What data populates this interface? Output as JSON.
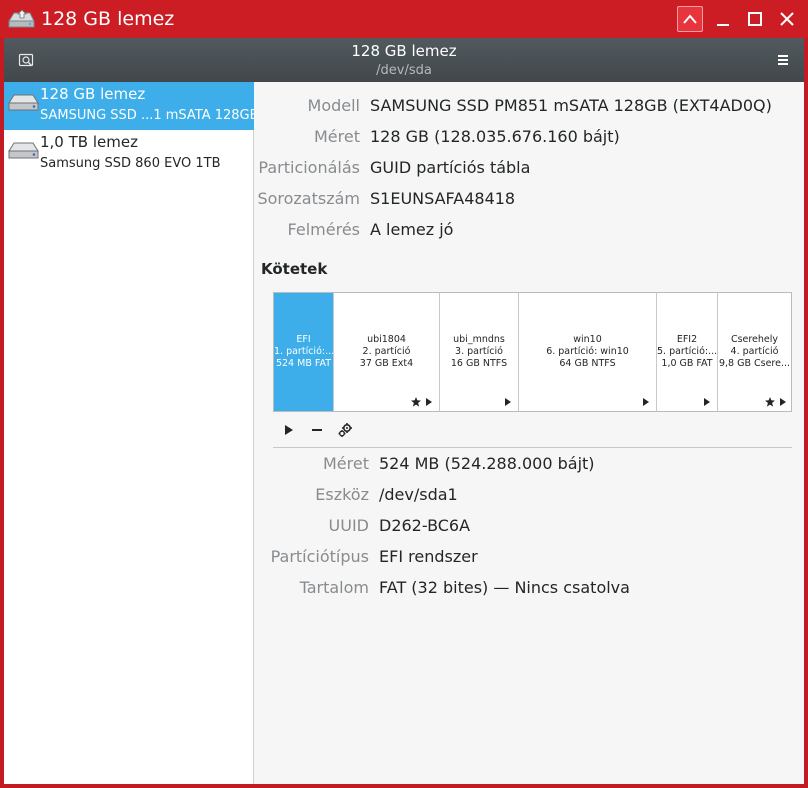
{
  "window": {
    "title": "128 GB lemez"
  },
  "header": {
    "title": "128 GB lemez",
    "subtitle": "/dev/sda"
  },
  "sidebar": {
    "drives": [
      {
        "name": "128 GB lemez",
        "subtitle": "SAMSUNG SSD ...1 mSATA 128GB",
        "selected": true
      },
      {
        "name": "1,0 TB lemez",
        "subtitle": "Samsung SSD 860 EVO 1TB",
        "selected": false
      }
    ]
  },
  "disk_info": [
    {
      "label": "Modell",
      "value": "SAMSUNG SSD PM851 mSATA 128GB (EXT4AD0Q)"
    },
    {
      "label": "Méret",
      "value": "128 GB (128.035.676.160 bájt)"
    },
    {
      "label": "Particionálás",
      "value": "GUID partíciós tábla"
    },
    {
      "label": "Sorozatszám",
      "value": "S1EUNSAFA48418"
    },
    {
      "label": "Felmérés",
      "value": "A lemez jó"
    }
  ],
  "volumes_title": "Kötetek",
  "volumes": [
    {
      "l1": "EFI",
      "l2": "1. partíció:...",
      "l3": "524 MB FAT",
      "selected": true,
      "star": false,
      "play": false
    },
    {
      "l1": "ubi1804",
      "l2": "2. partíció",
      "l3": "37 GB Ext4",
      "selected": false,
      "star": true,
      "play": true
    },
    {
      "l1": "ubi_mndns",
      "l2": "3. partíció",
      "l3": "16 GB NTFS",
      "selected": false,
      "star": false,
      "play": true
    },
    {
      "l1": "win10",
      "l2": "6. partíció: win10",
      "l3": "64 GB NTFS",
      "selected": false,
      "star": false,
      "play": true
    },
    {
      "l1": "EFI2",
      "l2": "5. partíció:...",
      "l3": "1,0 GB FAT",
      "selected": false,
      "star": false,
      "play": true
    },
    {
      "l1": "Cserehely",
      "l2": "4. partíció",
      "l3": "9,8 GB Csere...",
      "selected": false,
      "star": true,
      "play": true
    }
  ],
  "partition_info": [
    {
      "label": "Méret",
      "value": "524 MB (524.288.000 bájt)"
    },
    {
      "label": "Eszköz",
      "value": "/dev/sda1"
    },
    {
      "label": "UUID",
      "value": "D262-BC6A"
    },
    {
      "label": "Partíciótípus",
      "value": "EFI rendszer"
    },
    {
      "label": "Tartalom",
      "value": "FAT (32 bites) — Nincs csatolva"
    }
  ],
  "icons": {
    "app": "drive-harddisk-icon",
    "header_left": "disk-image-icon",
    "header_menu": "hamburger-menu-icon",
    "window_buttons": [
      "keep-above-icon",
      "minimize-icon",
      "maximize-icon",
      "close-icon"
    ],
    "toolbar": [
      "mount-play-icon",
      "delete-partition-icon",
      "settings-gears-icon"
    ]
  },
  "colors": {
    "titlebar": "#cc1c24",
    "selection": "#3daee9",
    "header": "#4a5155"
  }
}
